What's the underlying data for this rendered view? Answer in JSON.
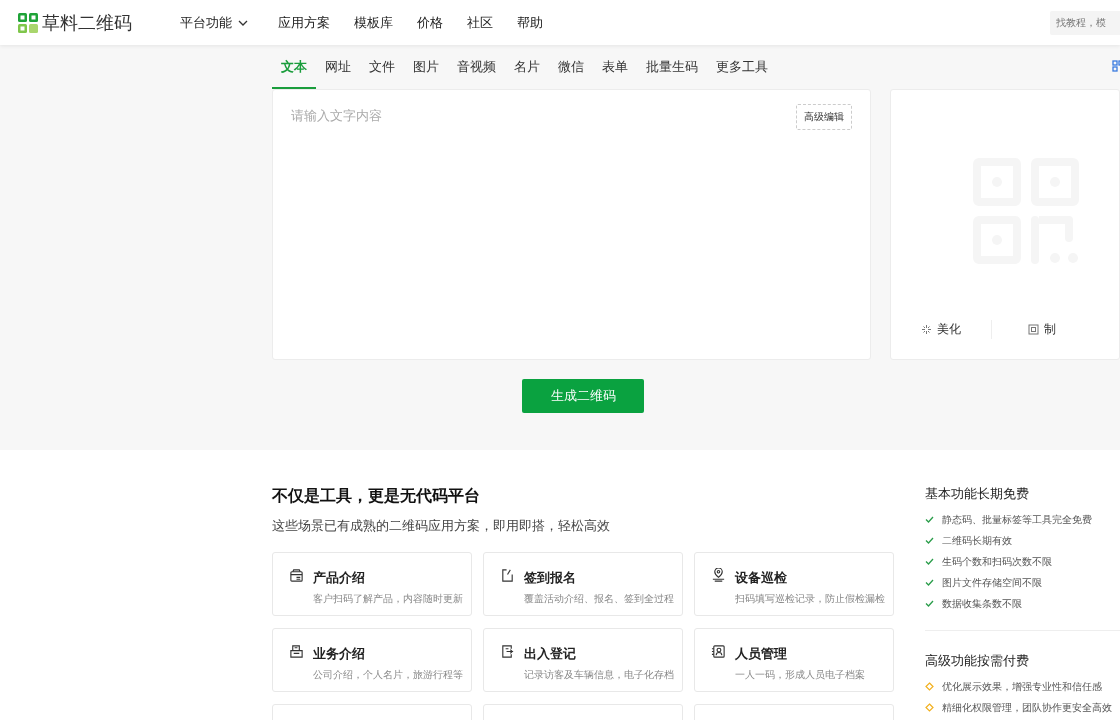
{
  "header": {
    "logo": "草料二维码",
    "nav": [
      {
        "label": "平台功能",
        "dropdown": true
      },
      {
        "label": "应用方案",
        "dropdown": false
      },
      {
        "label": "模板库",
        "dropdown": false
      },
      {
        "label": "价格",
        "dropdown": false
      },
      {
        "label": "社区",
        "dropdown": false
      },
      {
        "label": "帮助",
        "dropdown": false
      }
    ],
    "search": {
      "placeholder": "找教程，模"
    }
  },
  "tabs": [
    {
      "label": "文本",
      "selected": true
    },
    {
      "label": "网址",
      "selected": false
    },
    {
      "label": "文件",
      "selected": false
    },
    {
      "label": "图片",
      "selected": false
    },
    {
      "label": "音视频",
      "selected": false
    },
    {
      "label": "名片",
      "selected": false
    },
    {
      "label": "微信",
      "selected": false
    },
    {
      "label": "表单",
      "selected": false
    },
    {
      "label": "批量生码",
      "selected": false
    },
    {
      "label": "更多工具",
      "selected": false
    }
  ],
  "editor": {
    "placeholder": "请输入文字内容",
    "advanced_button": "高级编辑"
  },
  "preview": {
    "actions": [
      {
        "kind": "beautify",
        "label": "美化"
      },
      {
        "kind": "make",
        "label": "制"
      }
    ]
  },
  "generate_button": "生成二维码",
  "solutions": {
    "title": "不仅是工具，更是无代码平台",
    "subtitle": "这些场景已有成熟的二维码应用方案，即用即搭，轻松高效",
    "cards": [
      {
        "kind": "box",
        "title": "产品介绍",
        "desc": "客户扫码了解产品，内容随时更新"
      },
      {
        "kind": "sign",
        "title": "签到报名",
        "desc": "覆盖活动介绍、报名、签到全过程"
      },
      {
        "kind": "pin",
        "title": "设备巡检",
        "desc": "扫码填写巡检记录，防止假检漏检"
      },
      {
        "kind": "doc",
        "title": "业务介绍",
        "desc": "公司介绍，个人名片，旅游行程等"
      },
      {
        "kind": "door",
        "title": "出入登记",
        "desc": "记录访客及车辆信息，电子化存档"
      },
      {
        "kind": "person",
        "title": "人员管理",
        "desc": "一人一码，形成人员电子档案"
      }
    ]
  },
  "features": [
    {
      "kind": "free",
      "title": "基本功能长期免费",
      "items": [
        "静态码、批量标签等工具完全免费",
        "二维码长期有效",
        "生码个数和扫码次数不限",
        "图片文件存储空间不限",
        "数据收集条数不限"
      ]
    },
    {
      "kind": "paid",
      "title": "高级功能按需付费",
      "items": [
        "优化展示效果，增强专业性和信任感",
        "精细化权限管理，团队协作更安全高效"
      ]
    }
  ]
}
